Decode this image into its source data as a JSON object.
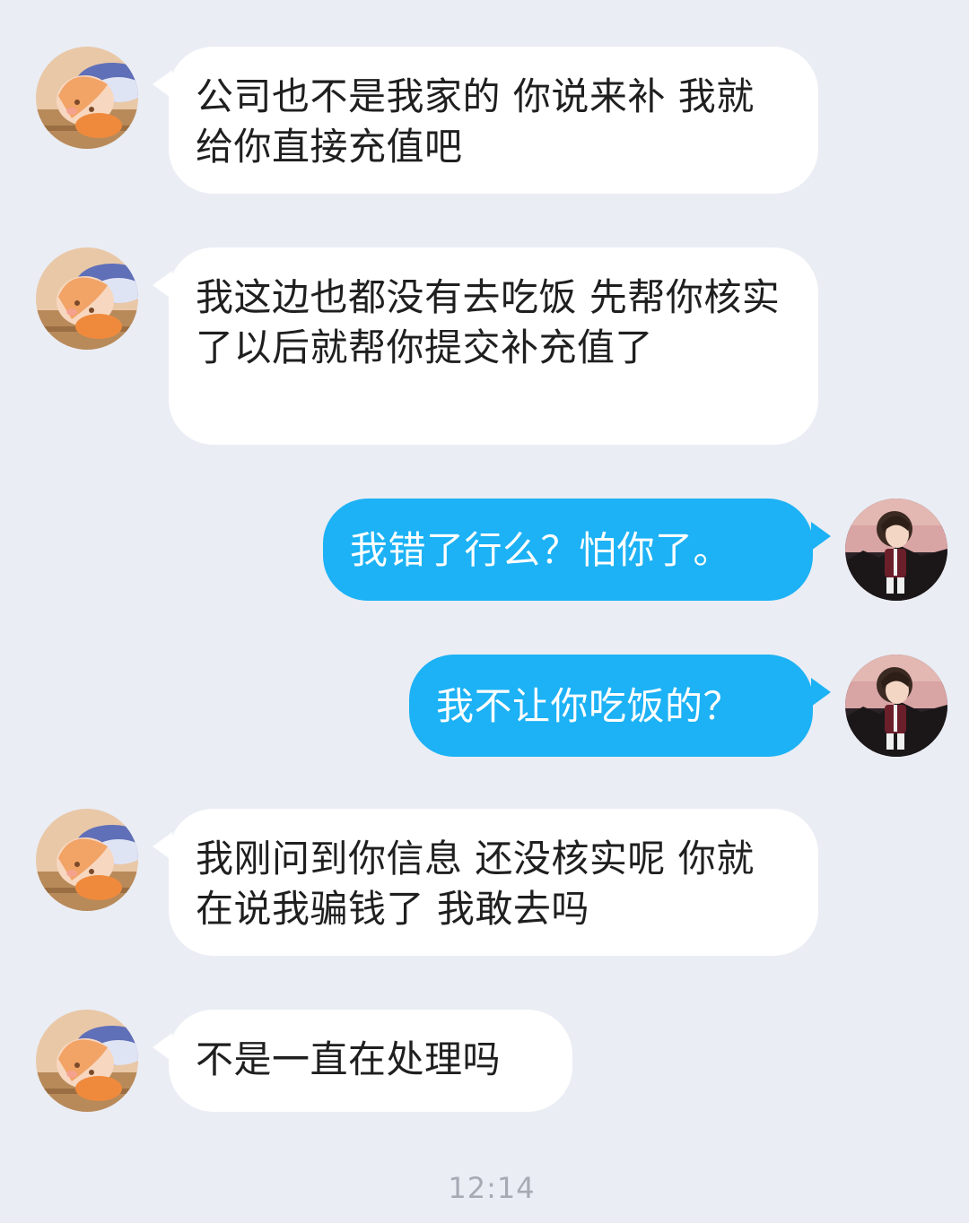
{
  "colors": {
    "background": "#eaedf4",
    "incoming_bubble": "#ffffff",
    "outgoing_bubble": "#1cb2f5",
    "timestamp": "#a7aab3"
  },
  "messages": [
    {
      "sender": "other",
      "avatar_icon": "anime-girl-avatar-icon",
      "text": "公司也不是我家的 你说来补 我就给你直接充值吧"
    },
    {
      "sender": "other",
      "avatar_icon": "anime-girl-avatar-icon",
      "text": "我这边也都没有去吃饭 先帮你核实了以后就帮你提交补充值了"
    },
    {
      "sender": "self",
      "avatar_icon": "cartoon-boy-avatar-icon",
      "text": "我错了行么？怕你了。"
    },
    {
      "sender": "self",
      "avatar_icon": "cartoon-boy-avatar-icon",
      "text": "我不让你吃饭的？"
    },
    {
      "sender": "other",
      "avatar_icon": "anime-girl-avatar-icon",
      "text": "我刚问到你信息 还没核实呢 你就在说我骗钱了 我敢去吗"
    },
    {
      "sender": "other",
      "avatar_icon": "anime-girl-avatar-icon",
      "text": "不是一直在处理吗"
    }
  ],
  "timestamp": "12:14"
}
